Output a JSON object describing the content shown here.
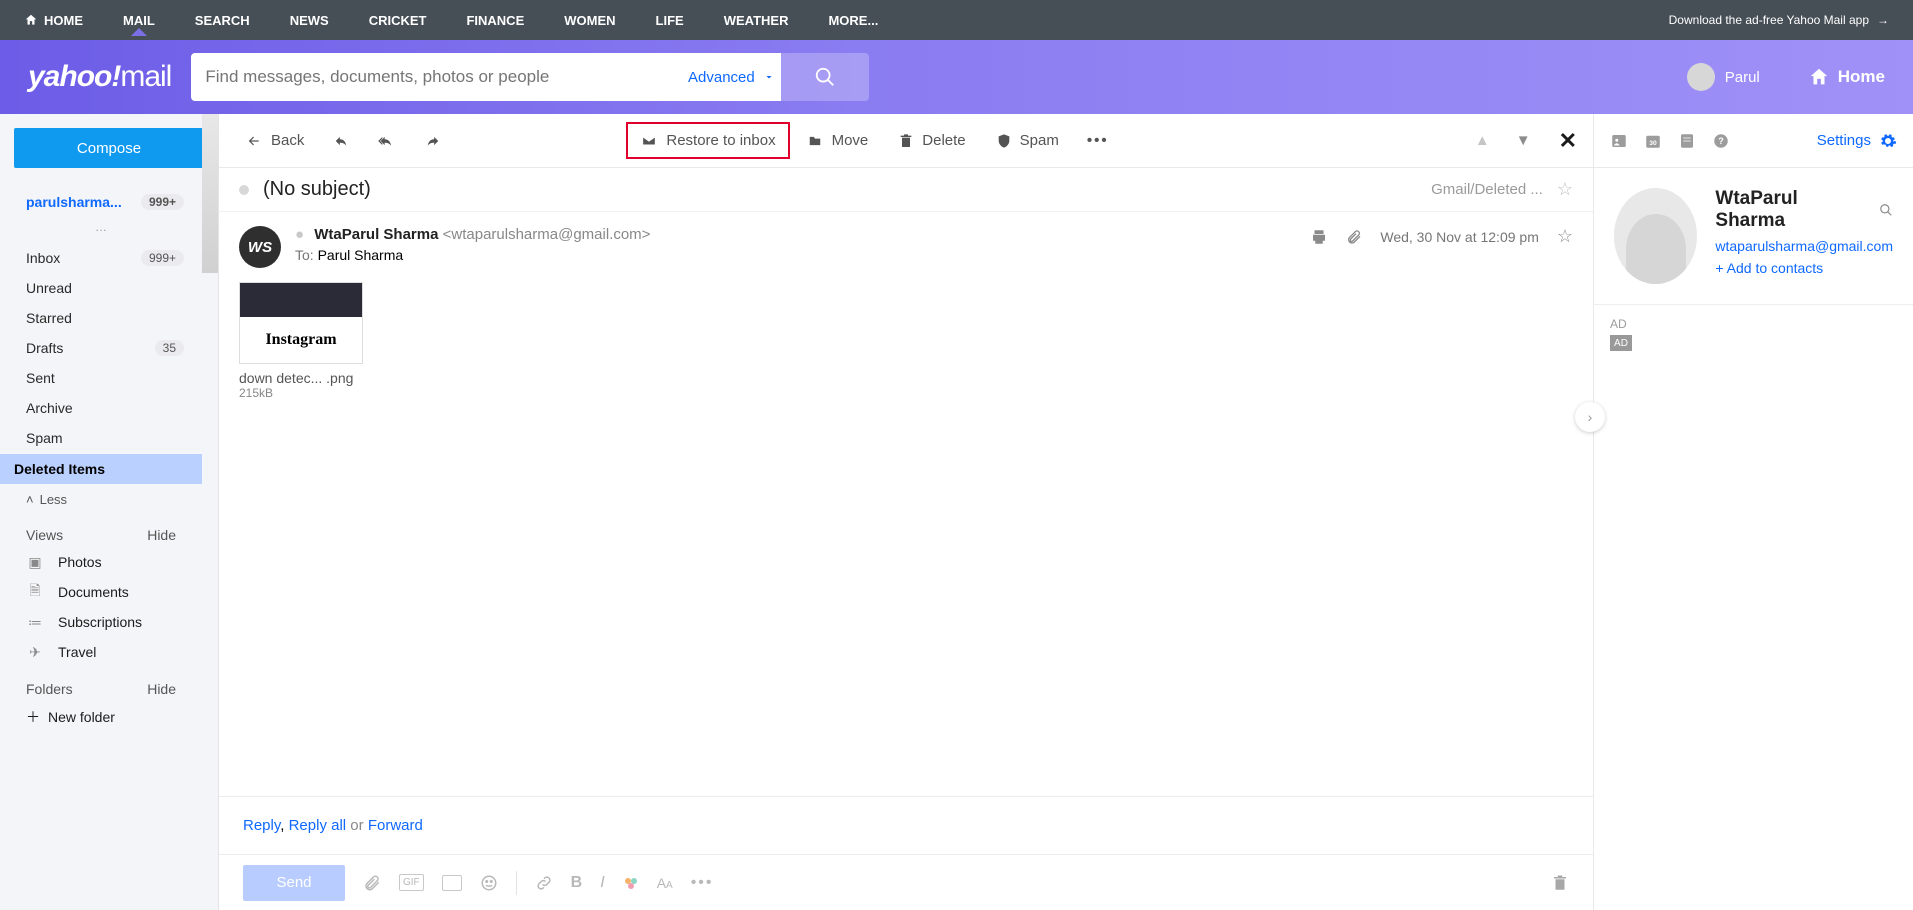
{
  "topnav": {
    "items": [
      "HOME",
      "MAIL",
      "SEARCH",
      "NEWS",
      "CRICKET",
      "FINANCE",
      "WOMEN",
      "LIFE",
      "WEATHER",
      "MORE..."
    ],
    "active_index": 1,
    "adlink": "Download the ad-free Yahoo Mail app"
  },
  "header": {
    "logo_a": "yahoo!",
    "logo_b": "mail",
    "search_placeholder": "Find messages, documents, photos or people",
    "advanced": "Advanced",
    "user_name": "Parul",
    "home": "Home"
  },
  "sidebar": {
    "compose": "Compose",
    "account": "parulsharma...",
    "account_badge": "999+",
    "folders": [
      {
        "label": "Inbox",
        "badge": "999+"
      },
      {
        "label": "Unread"
      },
      {
        "label": "Starred"
      },
      {
        "label": "Drafts",
        "badge": "35"
      },
      {
        "label": "Sent"
      },
      {
        "label": "Archive"
      },
      {
        "label": "Spam"
      },
      {
        "label": "Deleted Items",
        "selected": true
      }
    ],
    "less": "Less",
    "views_head": "Views",
    "hide": "Hide",
    "views": [
      {
        "icon": "photos-icon",
        "label": "Photos"
      },
      {
        "icon": "documents-icon",
        "label": "Documents"
      },
      {
        "icon": "subscriptions-icon",
        "label": "Subscriptions"
      },
      {
        "icon": "travel-icon",
        "label": "Travel"
      }
    ],
    "folders_head": "Folders",
    "newfolder": "New folder"
  },
  "toolbar": {
    "back": "Back",
    "restore": "Restore to inbox",
    "move": "Move",
    "delete": "Delete",
    "spam": "Spam"
  },
  "message": {
    "subject": "(No subject)",
    "path": "Gmail/Deleted ...",
    "from_name": "WtaParul Sharma",
    "from_email": "<wtaparulsharma@gmail.com>",
    "to_label": "To:",
    "to_name": "Parul Sharma",
    "date": "Wed, 30 Nov at 12:09 pm",
    "avatar_initials": "WS",
    "attachment": {
      "filename": "down detec... .png",
      "size": "215kB",
      "brand": "Instagram"
    }
  },
  "reply": {
    "reply": "Reply",
    "reply_all": "Reply all",
    "or": "or",
    "forward": "Forward"
  },
  "compose_bar": {
    "send": "Send"
  },
  "right": {
    "settings": "Settings",
    "name": "WtaParul Sharma",
    "email": "wtaparulsharma@gmail.com",
    "add": "+ Add to contacts",
    "ad_label": "AD",
    "ad_box": "AD"
  }
}
